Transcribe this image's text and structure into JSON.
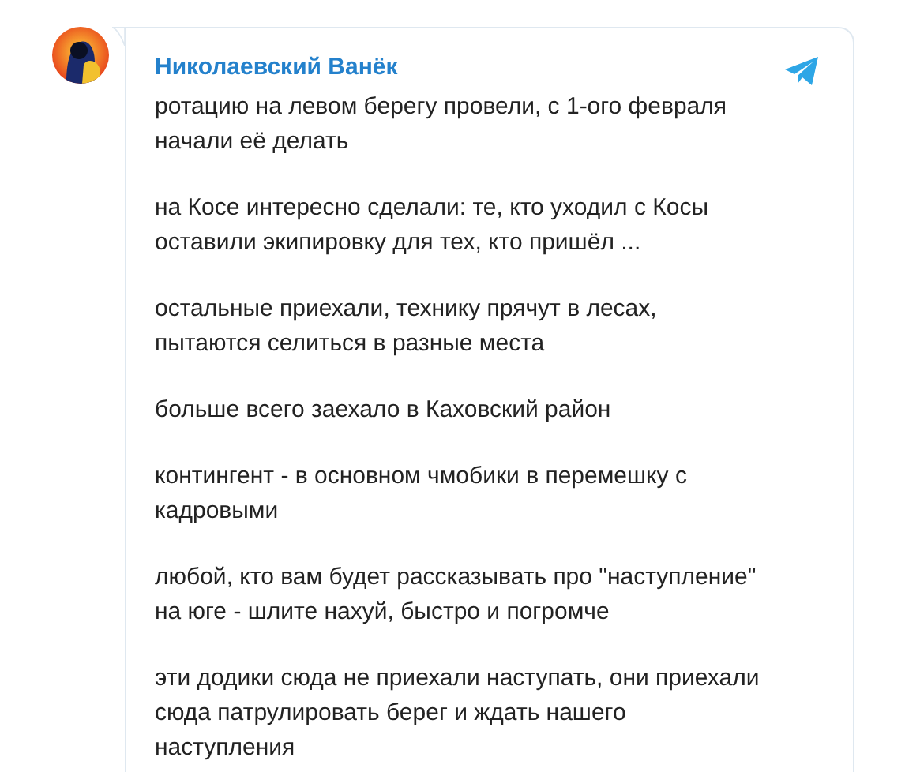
{
  "channel": {
    "name": "Николаевский Ванёк"
  },
  "message": {
    "paragraphs": [
      "ротацию на левом берегу провели, с 1-ого февраля\nначали её делать",
      "на Косе интересно сделали: те, кто уходил с Косы\nоставили экипировку для тех, кто пришёл ...",
      "остальные приехали, технику прячут в лесах,\nпытаются селиться в разные места",
      "больше всего заехало в Каховский район",
      "контингент - в основном чмобики в перемешку с\nкадровыми",
      "любой, кто вам будет рассказывать про \"наступление\"\nна юге - шлите нахуй, быстро и погромче",
      "эти додики сюда не приехали наступать, они приехали\nсюда патрулировать берег и ждать нашего\nнаступления"
    ]
  }
}
